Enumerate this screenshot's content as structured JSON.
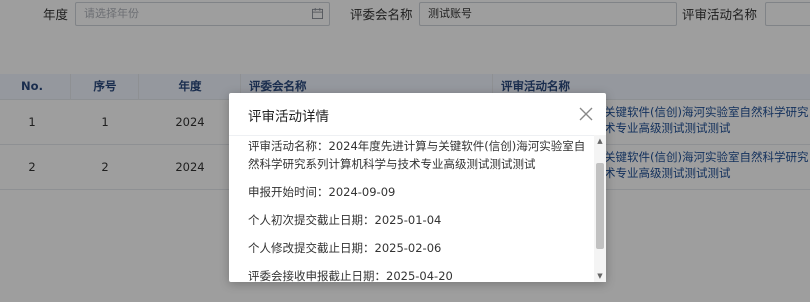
{
  "filters": {
    "year_label": "年度",
    "year_placeholder": "请选择年份",
    "committee_label": "评委会名称",
    "committee_value": "测试账号",
    "activity_label": "评审活动名称"
  },
  "table": {
    "headers": [
      "No.",
      "序号",
      "年度",
      "评委会名称",
      "评审活动名称"
    ],
    "rows": [
      {
        "no": "1",
        "seq": "1",
        "year": "2024",
        "activity_tail": "关键软件(信创)海河实验室自然科学研究",
        "activity_tail2": "术专业高级测试测试测试"
      },
      {
        "no": "2",
        "seq": "2",
        "year": "2024",
        "activity_tail": "关键软件(信创)海河实验室自然科学研究",
        "activity_tail2": "术专业高级测试测试测试"
      }
    ]
  },
  "modal": {
    "title": "评审活动详情",
    "details": {
      "name_line1": "评审活动名称：2024年度先进计算与关键软件(信创)海河实验室自",
      "name_line2": "然科学研究系列计算机科学与技术专业高级测试测试测试",
      "start_time": "申报开始时间：2024-09-09",
      "first_deadline": "个人初次提交截止日期：2025-01-04",
      "revise_deadline": "个人修改提交截止日期：2025-02-06",
      "committee_deadline": "评委会接收申报截止日期：2025-04-20"
    }
  },
  "icons": {
    "calendar": "calendar-icon",
    "close": "close-icon"
  }
}
